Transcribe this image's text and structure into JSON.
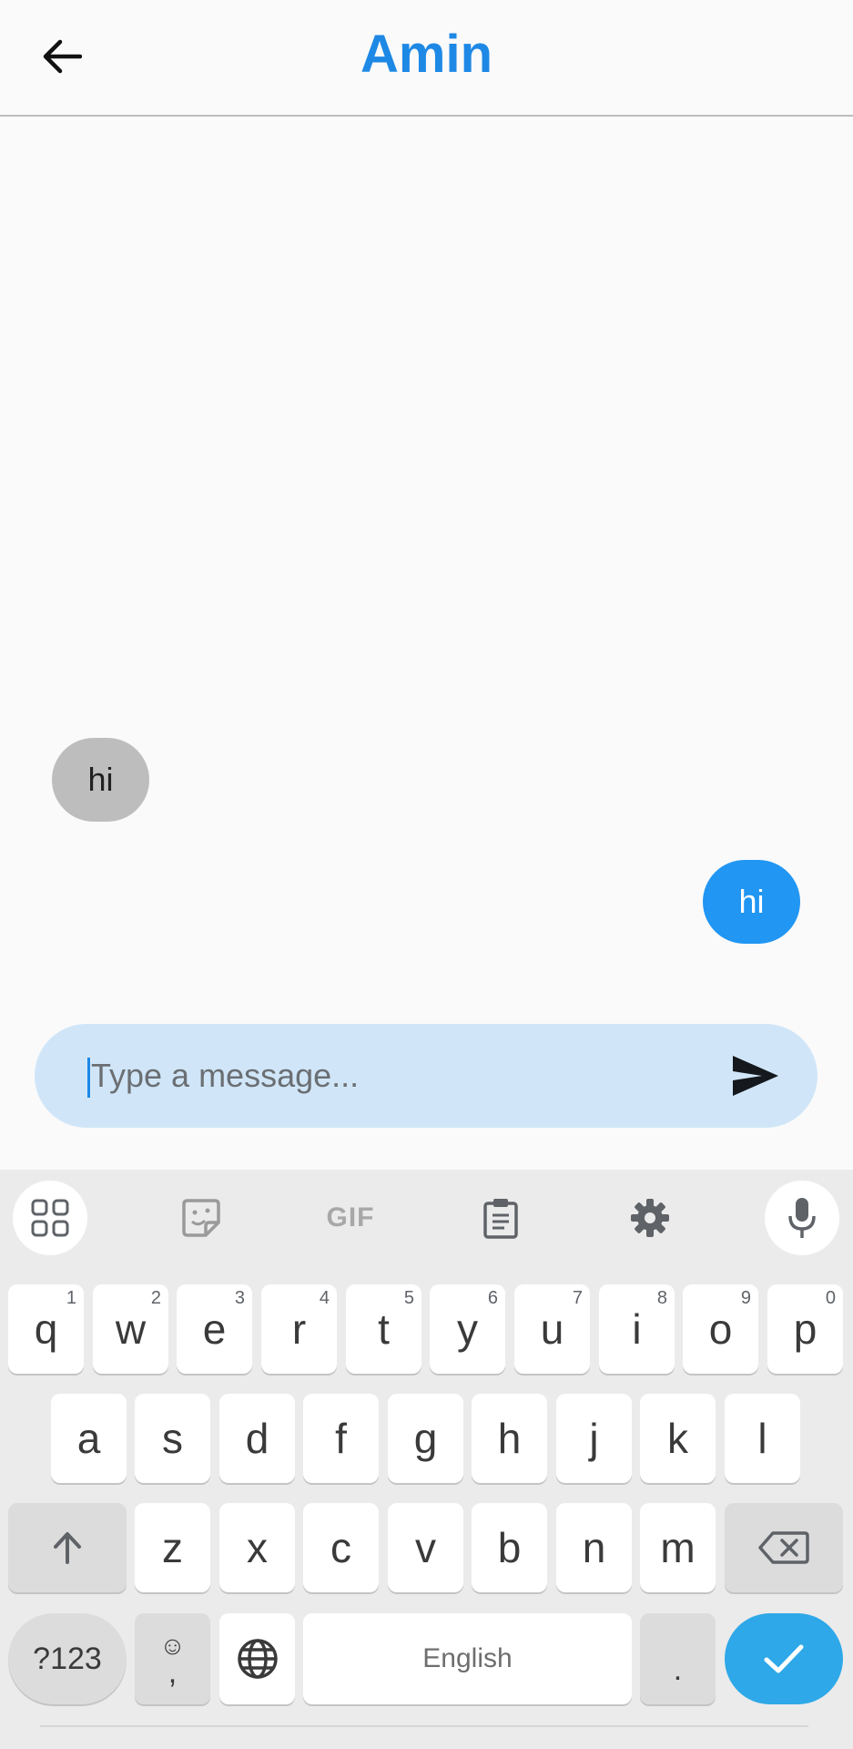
{
  "header": {
    "title": "Amin",
    "back_icon": "arrow-left-icon"
  },
  "messages": [
    {
      "direction": "incoming",
      "text": "hi"
    },
    {
      "direction": "outgoing",
      "text": "hi"
    }
  ],
  "composer": {
    "placeholder": "Type a message...",
    "value": "",
    "send_icon": "send-icon"
  },
  "colors": {
    "accent": "#1e88e5",
    "outgoing_bubble": "#2196f3",
    "incoming_bubble": "#bdbdbd",
    "composer_bg": "#d0e6f8",
    "enter_key": "#2ea8e8"
  },
  "keyboard": {
    "toolbar": [
      "apps-grid-icon",
      "sticker-icon",
      "gif-icon",
      "clipboard-icon",
      "settings-gear-icon",
      "microphone-icon"
    ],
    "gif_label": "GIF",
    "row1": [
      {
        "key": "q",
        "hint": "1"
      },
      {
        "key": "w",
        "hint": "2"
      },
      {
        "key": "e",
        "hint": "3"
      },
      {
        "key": "r",
        "hint": "4"
      },
      {
        "key": "t",
        "hint": "5"
      },
      {
        "key": "y",
        "hint": "6"
      },
      {
        "key": "u",
        "hint": "7"
      },
      {
        "key": "i",
        "hint": "8"
      },
      {
        "key": "o",
        "hint": "9"
      },
      {
        "key": "p",
        "hint": "0"
      }
    ],
    "row2": [
      "a",
      "s",
      "d",
      "f",
      "g",
      "h",
      "j",
      "k",
      "l"
    ],
    "row3": [
      "z",
      "x",
      "c",
      "v",
      "b",
      "n",
      "m"
    ],
    "symbols_label": "?123",
    "comma_label": ",",
    "space_label": "English",
    "period_label": "."
  }
}
